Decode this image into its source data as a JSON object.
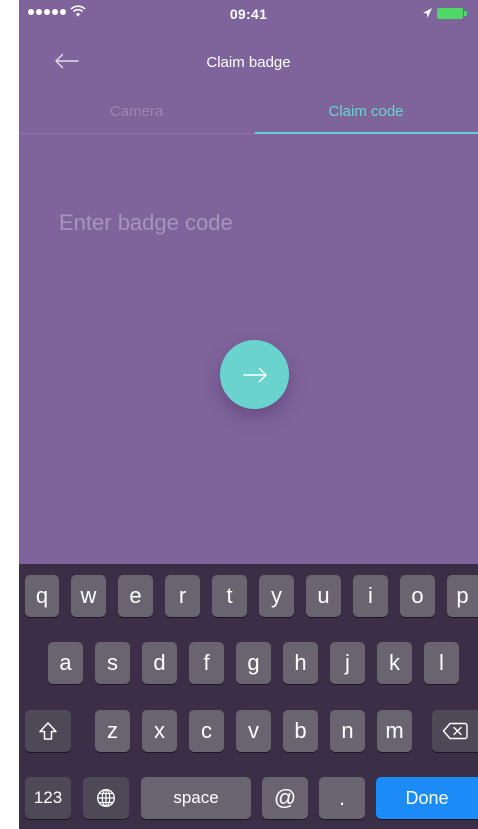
{
  "status_bar": {
    "time": "09:41"
  },
  "nav": {
    "title": "Claim badge"
  },
  "tabs": [
    {
      "label": "Camera",
      "selected": false
    },
    {
      "label": "Claim code",
      "selected": true
    }
  ],
  "code_input": {
    "placeholder": "Enter badge code",
    "value": ""
  },
  "colors": {
    "background": "#7f649b",
    "accent": "#67d3d0",
    "submit_button": "#6bd3cd",
    "done_key": "#1d8cf8"
  },
  "keyboard": {
    "row1": [
      "q",
      "w",
      "e",
      "r",
      "t",
      "y",
      "u",
      "i",
      "o",
      "p"
    ],
    "row2": [
      "a",
      "s",
      "d",
      "f",
      "g",
      "h",
      "j",
      "k",
      "l"
    ],
    "row3": [
      "z",
      "x",
      "c",
      "v",
      "b",
      "n",
      "m"
    ],
    "numbers_label": "123",
    "space_label": "space",
    "at_label": "@",
    "period_label": ".",
    "done_label": "Done"
  },
  "icons": {
    "back": "arrow-left-icon",
    "submit": "arrow-right-icon",
    "shift": "shift-icon",
    "delete": "backspace-icon",
    "globe": "globe-icon"
  }
}
